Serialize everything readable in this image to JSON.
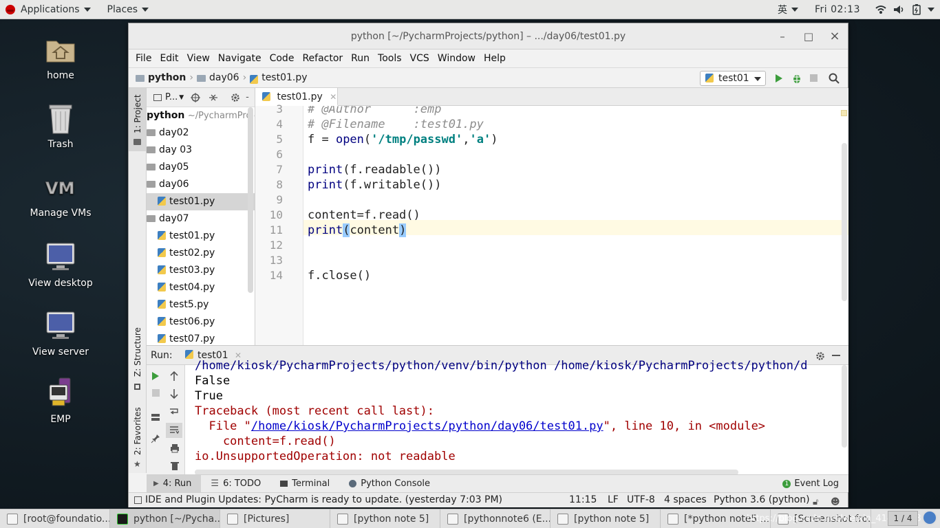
{
  "topbar": {
    "applications": "Applications",
    "places": "Places",
    "input_method": "英",
    "clock": "Fri 02:13"
  },
  "desktop": {
    "icons": [
      {
        "label": "home"
      },
      {
        "label": "Trash"
      },
      {
        "label": "Manage VMs"
      },
      {
        "label": "View desktop"
      },
      {
        "label": "View server"
      },
      {
        "label": "EMP"
      }
    ]
  },
  "window": {
    "title": "python [~/PycharmProjects/python] – .../day06/test01.py",
    "minimize": "–",
    "maximize": "□",
    "close": "×"
  },
  "menu": [
    "File",
    "Edit",
    "View",
    "Navigate",
    "Code",
    "Refactor",
    "Run",
    "Tools",
    "VCS",
    "Window",
    "Help"
  ],
  "breadcrumb": {
    "root": "python",
    "folder": "day06",
    "file": "test01.py"
  },
  "run_config": "test01",
  "side_tabs": {
    "project": "1: Project",
    "structure": "Z: Structure",
    "favorites": "2: Favorites"
  },
  "project_panel": {
    "header": "P...",
    "root_name": "python",
    "root_path": "~/PycharmProjects/python",
    "items": [
      {
        "label": "day02",
        "type": "folder",
        "indent": 0,
        "selected": false
      },
      {
        "label": "day 03",
        "type": "folder",
        "indent": 0,
        "selected": false
      },
      {
        "label": "day05",
        "type": "folder",
        "indent": 0,
        "selected": false
      },
      {
        "label": "day06",
        "type": "folder",
        "indent": 0,
        "selected": false
      },
      {
        "label": "test01.py",
        "type": "file",
        "indent": 1,
        "selected": true
      },
      {
        "label": "day07",
        "type": "folder",
        "indent": 0,
        "selected": false
      },
      {
        "label": "test01.py",
        "type": "file",
        "indent": 1,
        "selected": false
      },
      {
        "label": "test02.py",
        "type": "file",
        "indent": 1,
        "selected": false
      },
      {
        "label": "test03.py",
        "type": "file",
        "indent": 1,
        "selected": false
      },
      {
        "label": "test04.py",
        "type": "file",
        "indent": 1,
        "selected": false
      },
      {
        "label": "test5.py",
        "type": "file",
        "indent": 1,
        "selected": false
      },
      {
        "label": "test06.py",
        "type": "file",
        "indent": 1,
        "selected": false
      },
      {
        "label": "test07.py",
        "type": "file",
        "indent": 1,
        "selected": false
      }
    ]
  },
  "editor": {
    "tab": "test01.py",
    "lines": [
      {
        "num": "3",
        "segments": [
          {
            "t": "# @Author      :emp",
            "c": "cm"
          }
        ]
      },
      {
        "num": "4",
        "segments": [
          {
            "t": "# @Filename    :test01.py",
            "c": "cm"
          }
        ]
      },
      {
        "num": "5",
        "segments": [
          {
            "t": "f = ",
            "c": ""
          },
          {
            "t": "open",
            "c": "kw"
          },
          {
            "t": "(",
            "c": ""
          },
          {
            "t": "'/tmp/passwd'",
            "c": "str"
          },
          {
            "t": ",",
            "c": ""
          },
          {
            "t": "'a'",
            "c": "str"
          },
          {
            "t": ")",
            "c": ""
          }
        ]
      },
      {
        "num": "6",
        "segments": []
      },
      {
        "num": "7",
        "segments": [
          {
            "t": "print",
            "c": "kw"
          },
          {
            "t": "(f.readable())",
            "c": ""
          }
        ]
      },
      {
        "num": "8",
        "segments": [
          {
            "t": "print",
            "c": "kw"
          },
          {
            "t": "(f.writable())",
            "c": ""
          }
        ]
      },
      {
        "num": "9",
        "segments": []
      },
      {
        "num": "10",
        "segments": [
          {
            "t": "content=f.read()",
            "c": ""
          }
        ]
      },
      {
        "num": "11",
        "segments": [
          {
            "t": "print",
            "c": "kw"
          },
          {
            "t": "(",
            "c": "brk"
          },
          {
            "t": "content",
            "c": ""
          },
          {
            "t": ")",
            "c": "brk"
          }
        ],
        "current": true
      },
      {
        "num": "12",
        "segments": []
      },
      {
        "num": "13",
        "segments": []
      },
      {
        "num": "14",
        "segments": [
          {
            "t": "f.close()",
            "c": ""
          }
        ]
      }
    ]
  },
  "run": {
    "label": "Run:",
    "tab": "test01",
    "output": [
      {
        "segments": [
          {
            "t": "/home/kiosk/PycharmProjects/python/venv/bin/python /home/kiosk/PycharmProjects/python/d",
            "c": "#000080"
          }
        ]
      },
      {
        "segments": [
          {
            "t": "False",
            "c": "#000000"
          }
        ]
      },
      {
        "segments": [
          {
            "t": "True",
            "c": "#000000"
          }
        ]
      },
      {
        "segments": [
          {
            "t": "Traceback (most recent call last):",
            "c": "#a00000"
          }
        ]
      },
      {
        "segments": [
          {
            "t": "  File \"",
            "c": "#a00000"
          },
          {
            "t": "/home/kiosk/PycharmProjects/python/day06/test01.py",
            "c": "#0000cc",
            "u": true
          },
          {
            "t": "\", line 10, in <module>",
            "c": "#a00000"
          }
        ]
      },
      {
        "segments": [
          {
            "t": "    content=f.read()",
            "c": "#a00000"
          }
        ]
      },
      {
        "segments": [
          {
            "t": "io.UnsupportedOperation: not readable",
            "c": "#a00000"
          }
        ]
      }
    ]
  },
  "bottom_tabs": {
    "run": "4: Run",
    "todo": "6: TODO",
    "terminal": "Terminal",
    "console": "Python Console",
    "event_log": "Event Log"
  },
  "status": {
    "message": "IDE and Plugin Updates: PyCharm is ready to update. (yesterday 7:03 PM)",
    "position": "11:15",
    "line_sep": "LF",
    "encoding": "UTF-8",
    "indent": "4 spaces",
    "interpreter": "Python 3.6 (python)"
  },
  "taskbar": [
    {
      "label": "[root@foundatio...",
      "active": false
    },
    {
      "label": "python [~/Pycha...",
      "active": true
    },
    {
      "label": "[Pictures]",
      "active": false
    },
    {
      "label": "[python note 5]",
      "active": false
    },
    {
      "label": "[pythonnote6 (E...",
      "active": false
    },
    {
      "label": "[python note 5]",
      "active": false
    },
    {
      "label": "[*python note5 ...",
      "active": false
    },
    {
      "label": "[Screenshot fro...",
      "active": false
    }
  ],
  "watermark": "https://blog.csdn.net/weixin_41476978",
  "workspace": "1 / 4"
}
